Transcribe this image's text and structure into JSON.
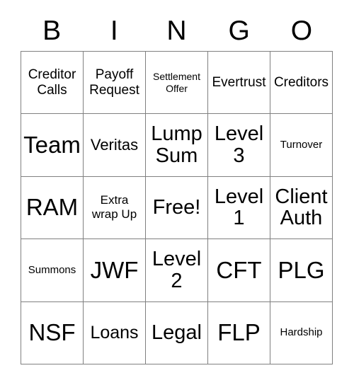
{
  "card": {
    "header_letters": [
      "B",
      "I",
      "N",
      "G",
      "O"
    ],
    "border_color": "#808080",
    "text_color": "#000000",
    "background_color": "#ffffff",
    "columns": 5,
    "rows": 5,
    "cells": [
      {
        "text": "Creditor Calls",
        "size": "md",
        "column": "B",
        "row": 1
      },
      {
        "text": "Payoff Request",
        "size": "md",
        "column": "I",
        "row": 1
      },
      {
        "text": "Settlement Offer",
        "size": "xs",
        "column": "N",
        "row": 1
      },
      {
        "text": "Evertrust",
        "size": "md",
        "column": "G",
        "row": 1
      },
      {
        "text": "Creditors",
        "size": "md",
        "column": "O",
        "row": 1
      },
      {
        "text": "Team",
        "size": "huge",
        "column": "B",
        "row": 2
      },
      {
        "text": "Veritas",
        "size": "lg",
        "column": "I",
        "row": 2
      },
      {
        "text": "Lump Sum",
        "size": "xxl",
        "column": "N",
        "row": 2
      },
      {
        "text": "Level 3",
        "size": "xxl",
        "column": "G",
        "row": 2
      },
      {
        "text": "Turnover",
        "size": "sm",
        "column": "O",
        "row": 2
      },
      {
        "text": "RAM",
        "size": "huge",
        "column": "B",
        "row": 3
      },
      {
        "text": "Extra wrap Up",
        "size": "smd",
        "column": "I",
        "row": 3
      },
      {
        "text": "Free!",
        "size": "xxl",
        "column": "N",
        "row": 3
      },
      {
        "text": "Level 1",
        "size": "xxl",
        "column": "G",
        "row": 3
      },
      {
        "text": "Client Auth",
        "size": "xxl",
        "column": "O",
        "row": 3
      },
      {
        "text": "Summons",
        "size": "sm",
        "column": "B",
        "row": 4
      },
      {
        "text": "JWF",
        "size": "huge",
        "column": "I",
        "row": 4
      },
      {
        "text": "Level 2",
        "size": "xxl",
        "column": "N",
        "row": 4
      },
      {
        "text": "CFT",
        "size": "huge",
        "column": "G",
        "row": 4
      },
      {
        "text": "PLG",
        "size": "huge",
        "column": "O",
        "row": 4
      },
      {
        "text": "NSF",
        "size": "huge",
        "column": "B",
        "row": 5
      },
      {
        "text": "Loans",
        "size": "xl",
        "column": "I",
        "row": 5
      },
      {
        "text": "Legal",
        "size": "xxl",
        "column": "N",
        "row": 5
      },
      {
        "text": "FLP",
        "size": "huge",
        "column": "G",
        "row": 5
      },
      {
        "text": "Hardship",
        "size": "sm",
        "column": "O",
        "row": 5
      }
    ]
  }
}
